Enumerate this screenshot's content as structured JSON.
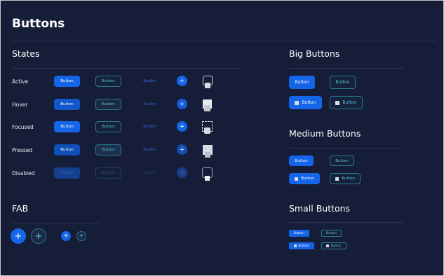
{
  "page": {
    "title": "Buttons"
  },
  "states": {
    "heading": "States",
    "rows": [
      {
        "label": "Active",
        "button": "Button",
        "plus": "+"
      },
      {
        "label": "Hover",
        "button": "Button",
        "plus": "+"
      },
      {
        "label": "Focused",
        "button": "Button",
        "plus": "+"
      },
      {
        "label": "Pressed",
        "button": "Button",
        "plus": "+"
      },
      {
        "label": "Disabled",
        "button": "Button",
        "plus": "+"
      }
    ]
  },
  "fab": {
    "heading": "FAB",
    "plus": "+"
  },
  "big": {
    "heading": "Big Buttons",
    "button": "Button"
  },
  "medium": {
    "heading": "Medium Buttons",
    "button": "Button"
  },
  "small": {
    "heading": "Small Buttons",
    "button": "Button"
  },
  "colors": {
    "background": "#161d38",
    "primary": "#1565e8",
    "outline": "#2a7b86",
    "outline_text": "#5fc3d3"
  }
}
